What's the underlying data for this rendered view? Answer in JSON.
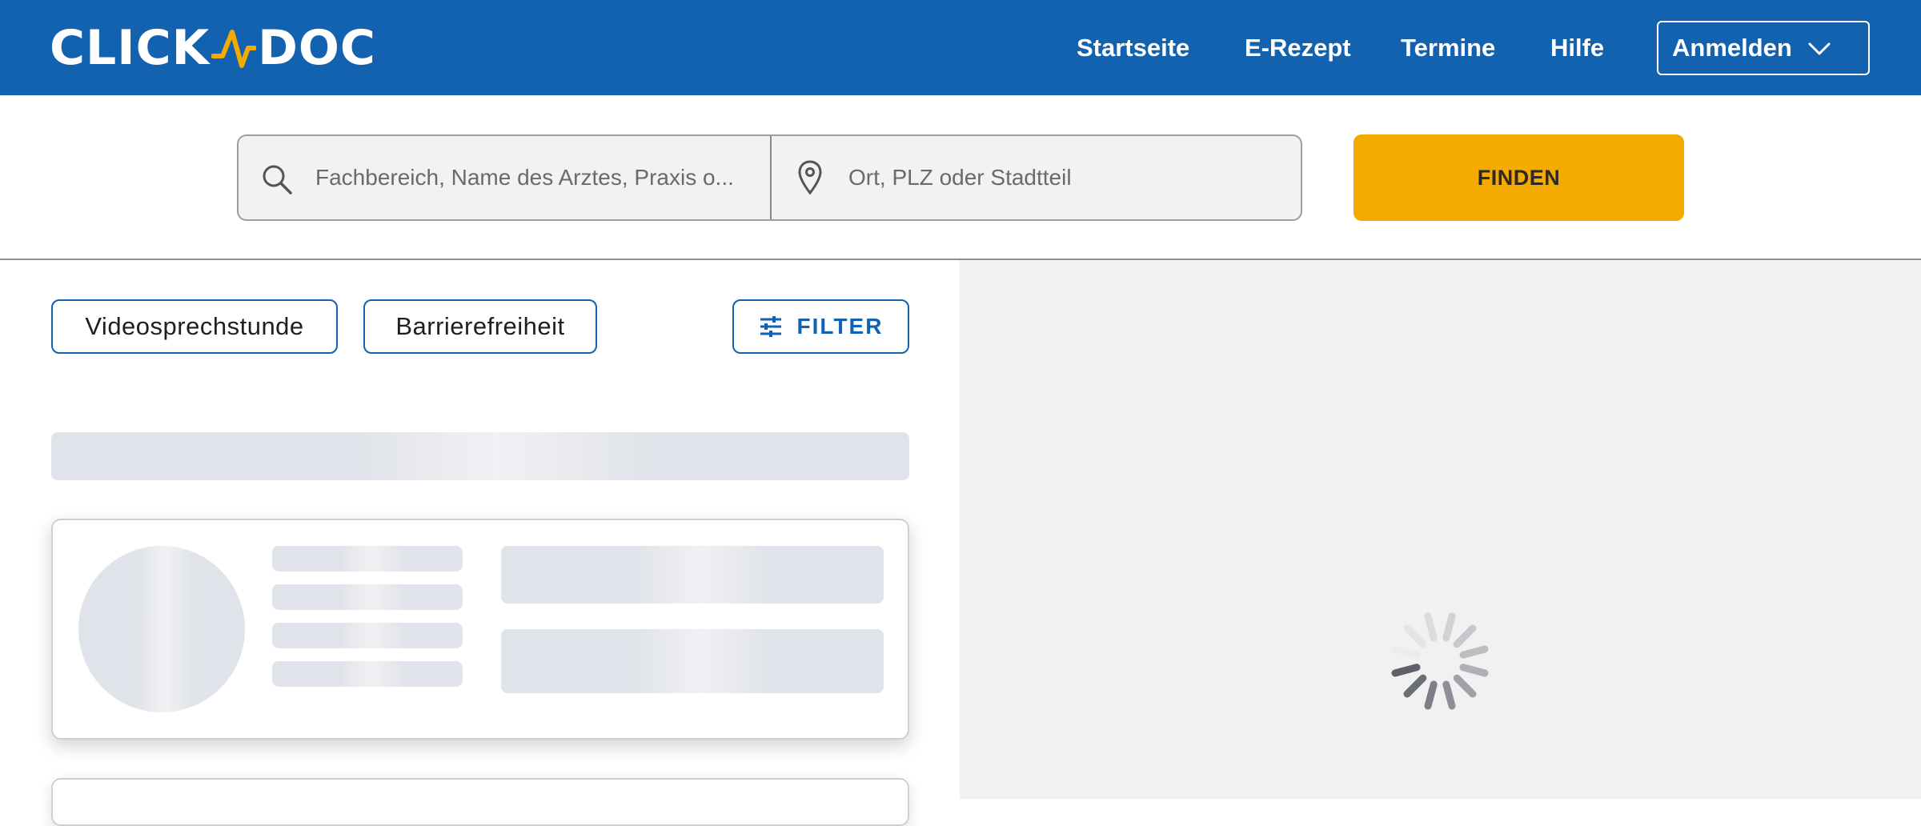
{
  "header": {
    "logo_left": "CLICK",
    "logo_right": "DOC",
    "nav": {
      "startseite": "Startseite",
      "erezept": "E-Rezept",
      "termine": "Termine",
      "hilfe": "Hilfe"
    },
    "login_label": "Anmelden"
  },
  "search": {
    "query_placeholder": "Fachbereich, Name des Arztes, Praxis o...",
    "location_placeholder": "Ort, PLZ oder Stadtteil",
    "find_label": "FINDEN"
  },
  "filters": {
    "chip_video": "Videosprechstunde",
    "chip_barrier": "Barrierefreiheit",
    "filter_label": "FILTER"
  },
  "colors": {
    "brand_blue": "#1262b0",
    "accent_yellow": "#f5aa00"
  },
  "icons": {
    "search": "search-icon",
    "location": "map-pin-icon",
    "chevron": "chevron-down-icon",
    "filter": "sliders-icon",
    "loading": "loading-spinner-icon"
  }
}
